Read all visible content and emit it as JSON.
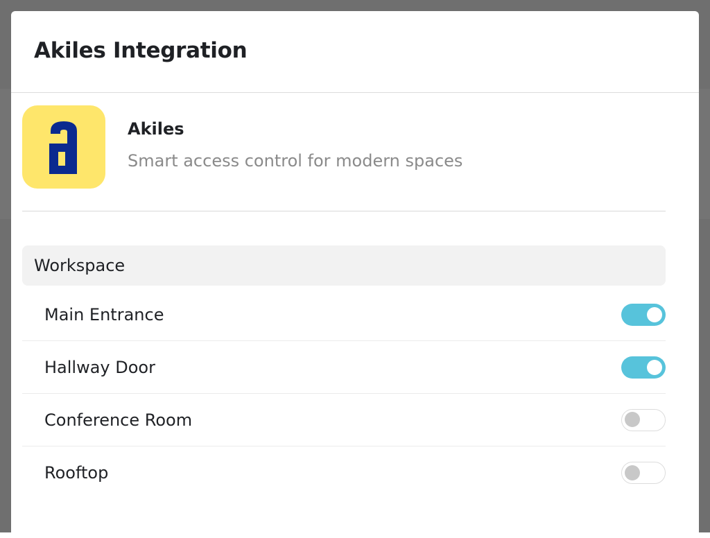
{
  "modal": {
    "title": "Akiles Integration"
  },
  "app": {
    "name": "Akiles",
    "description": "Smart access control for modern spaces",
    "logo_icon": "akiles-logo-icon",
    "logo_bg": "#fee66b",
    "logo_fg": "#0b2a8f"
  },
  "section": {
    "title": "Workspace"
  },
  "doors": [
    {
      "label": "Main Entrance",
      "enabled": true
    },
    {
      "label": "Hallway Door",
      "enabled": true
    },
    {
      "label": "Conference Room",
      "enabled": false
    },
    {
      "label": "Rooftop",
      "enabled": false
    }
  ],
  "colors": {
    "toggle_on": "#57c3db",
    "toggle_off_knob": "#c8c8c8"
  }
}
